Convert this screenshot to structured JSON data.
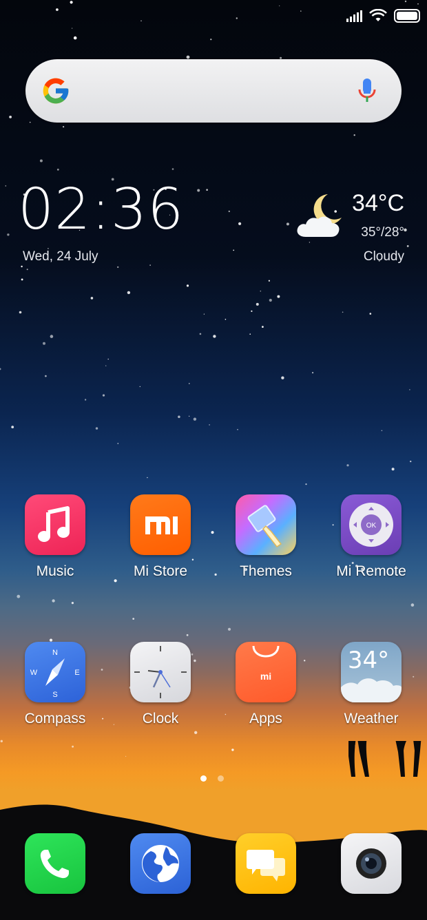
{
  "status": {
    "signal": "signal-icon",
    "wifi": "wifi-icon",
    "battery": "battery-icon"
  },
  "search": {
    "logo": "google-g-icon",
    "mic": "mic-icon"
  },
  "clock": {
    "time": "02:36",
    "date": "Wed, 24 July"
  },
  "weather": {
    "temp": "34°C",
    "range": "35°/28°",
    "condition": "Cloudy",
    "icon": "moon-cloud-icon"
  },
  "apps": [
    {
      "label": "Music",
      "icon": "music-note-icon"
    },
    {
      "label": "Mi Store",
      "icon": "mi-logo-icon"
    },
    {
      "label": "Themes",
      "icon": "paintbrush-icon"
    },
    {
      "label": "Mi Remote",
      "icon": "remote-dpad-icon",
      "badge": "OK"
    },
    {
      "label": "Compass",
      "icon": "compass-icon",
      "letters": [
        "N",
        "E",
        "S",
        "W"
      ]
    },
    {
      "label": "Clock",
      "icon": "clock-face-icon"
    },
    {
      "label": "Apps",
      "icon": "shopping-bag-icon",
      "badge": "mi"
    },
    {
      "label": "Weather",
      "icon": "weather-cloud-icon",
      "badge": "34°"
    }
  ],
  "dock": [
    {
      "name": "Phone",
      "icon": "phone-icon"
    },
    {
      "name": "Browser",
      "icon": "globe-icon"
    },
    {
      "name": "Messaging",
      "icon": "chat-bubbles-icon"
    },
    {
      "name": "Camera",
      "icon": "camera-lens-icon"
    }
  ],
  "pager": {
    "pages": 2,
    "current": 1
  },
  "colors": {
    "music": "#f23c6a",
    "mistore": "#ff6900",
    "remote": "#7b4fc0",
    "compass": "#3f78e8",
    "apps": "#ff6a3a",
    "phone": "#22d24a",
    "browser": "#3d7be0",
    "messages": "#ffc21a"
  }
}
